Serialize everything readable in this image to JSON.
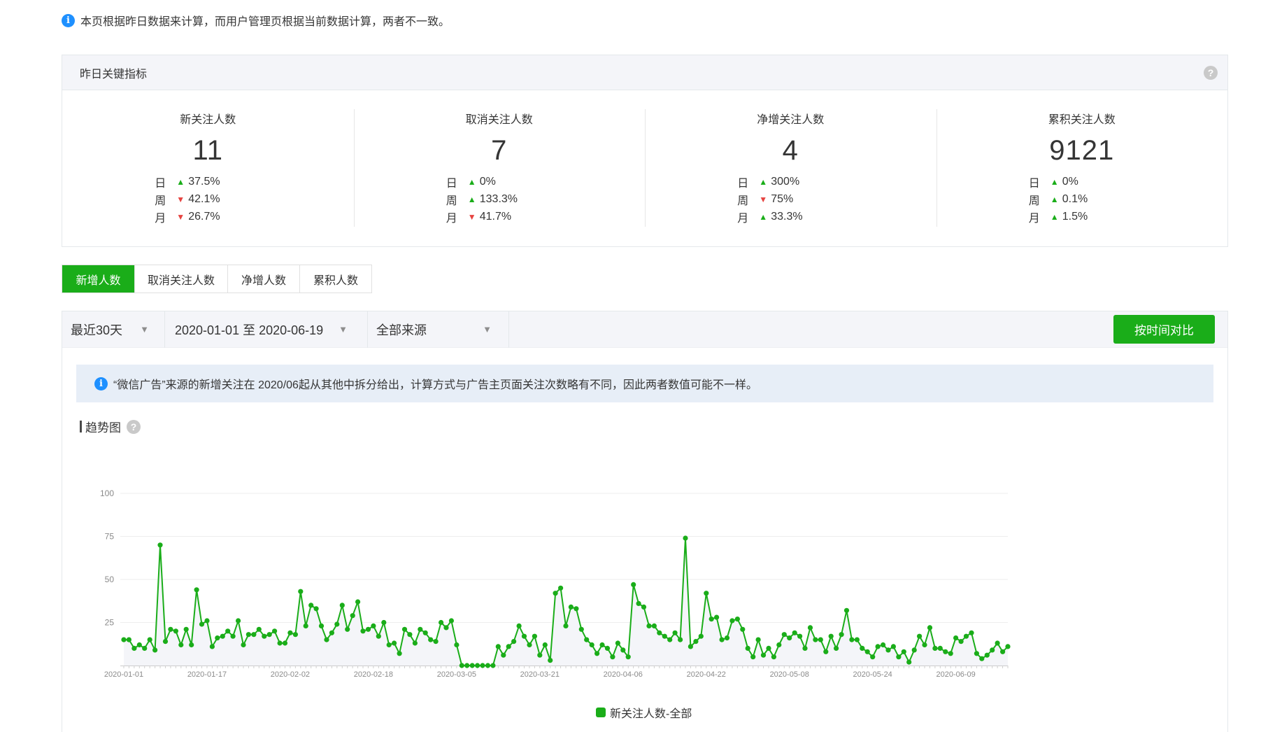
{
  "notice_top": "本页根据昨日数据来计算，而用户管理页根据当前数据计算，两者不一致。",
  "kpi": {
    "title": "昨日关键指标",
    "cards": [
      {
        "name": "新关注人数",
        "value": "11",
        "changes": [
          {
            "label": "日",
            "dir": "up",
            "pct": "37.5%"
          },
          {
            "label": "周",
            "dir": "down",
            "pct": "42.1%"
          },
          {
            "label": "月",
            "dir": "down",
            "pct": "26.7%"
          }
        ]
      },
      {
        "name": "取消关注人数",
        "value": "7",
        "changes": [
          {
            "label": "日",
            "dir": "up",
            "pct": "0%"
          },
          {
            "label": "周",
            "dir": "up",
            "pct": "133.3%"
          },
          {
            "label": "月",
            "dir": "down",
            "pct": "41.7%"
          }
        ]
      },
      {
        "name": "净增关注人数",
        "value": "4",
        "changes": [
          {
            "label": "日",
            "dir": "up",
            "pct": "300%"
          },
          {
            "label": "周",
            "dir": "down",
            "pct": "75%"
          },
          {
            "label": "月",
            "dir": "up",
            "pct": "33.3%"
          }
        ]
      },
      {
        "name": "累积关注人数",
        "value": "9121",
        "changes": [
          {
            "label": "日",
            "dir": "up",
            "pct": "0%"
          },
          {
            "label": "周",
            "dir": "up",
            "pct": "0.1%"
          },
          {
            "label": "月",
            "dir": "up",
            "pct": "1.5%"
          }
        ]
      }
    ]
  },
  "tabs": [
    "新增人数",
    "取消关注人数",
    "净增人数",
    "累积人数"
  ],
  "active_tab": 0,
  "filters": {
    "period": "最近30天",
    "date_range": "2020-01-01 至 2020-06-19",
    "source": "全部来源",
    "compare_button": "按时间对比"
  },
  "notice_blue": "“微信广告”来源的新增关注在 2020/06起从其他中拆分给出，计算方式与广告主页面关注次数略有不同，因此两者数值可能不一样。",
  "trend_title": "趋势图",
  "colors": {
    "accent": "#1aad19",
    "up": "#1aad19",
    "down": "#e64340"
  },
  "chart_data": {
    "type": "line",
    "title": "",
    "xlabel": "",
    "ylabel": "",
    "ylim": [
      0,
      100
    ],
    "yticks": [
      25,
      50,
      75,
      100
    ],
    "grid": true,
    "legend": "bottom-center",
    "x_start": "2020-01-01",
    "x_end": "2020-06-19",
    "x_ticks": [
      "2020-01-01",
      "2020-01-17",
      "2020-02-02",
      "2020-02-18",
      "2020-03-05",
      "2020-03-21",
      "2020-04-06",
      "2020-04-22",
      "2020-05-08",
      "2020-05-24",
      "2020-06-09"
    ],
    "series": [
      {
        "name": "新关注人数-全部",
        "color": "#1aad19",
        "values": [
          15,
          15,
          10,
          12,
          10,
          15,
          9,
          70,
          14,
          21,
          20,
          12,
          21,
          12,
          44,
          24,
          26,
          11,
          16,
          17,
          20,
          17,
          26,
          12,
          18,
          18,
          21,
          17,
          18,
          20,
          13,
          13,
          19,
          18,
          43,
          23,
          35,
          33,
          23,
          15,
          19,
          24,
          35,
          21,
          29,
          37,
          20,
          21,
          23,
          17,
          25,
          12,
          13,
          7,
          21,
          18,
          13,
          21,
          19,
          15,
          14,
          25,
          22,
          26,
          12,
          0,
          0,
          0,
          0,
          0,
          0,
          0,
          11,
          6,
          11,
          14,
          23,
          17,
          12,
          17,
          6,
          12,
          3,
          42,
          45,
          23,
          34,
          33,
          21,
          15,
          12,
          7,
          12,
          10,
          5,
          13,
          9,
          5,
          47,
          36,
          34,
          23,
          23,
          19,
          17,
          15,
          19,
          15,
          74,
          11,
          14,
          17,
          42,
          27,
          28,
          15,
          16,
          26,
          27,
          21,
          10,
          5,
          15,
          6,
          10,
          5,
          12,
          18,
          16,
          19,
          17,
          10,
          22,
          15,
          15,
          8,
          17,
          10,
          18,
          32,
          15,
          15,
          10,
          8,
          5,
          11,
          12,
          9,
          11,
          5,
          8,
          2,
          9,
          17,
          12,
          22,
          10,
          10,
          8,
          7,
          16,
          14,
          17,
          19,
          7,
          4,
          6,
          9,
          13,
          8,
          11
        ]
      }
    ]
  }
}
